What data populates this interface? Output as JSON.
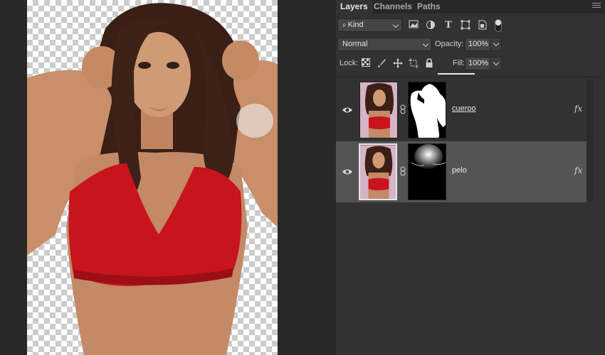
{
  "tabs": [
    {
      "label": "Layers",
      "active": true
    },
    {
      "label": "Channels",
      "active": false
    },
    {
      "label": "Paths",
      "active": false
    }
  ],
  "filter": {
    "kind_label": "Kind"
  },
  "blend": {
    "mode": "Normal",
    "opacity_label": "Opacity:",
    "opacity_value": "100%"
  },
  "lock": {
    "label": "Lock:",
    "fill_label": "Fill:",
    "fill_value": "100%"
  },
  "layers": [
    {
      "name": "cuerpo",
      "selected": false,
      "fx": "fx"
    },
    {
      "name": "pelo",
      "selected": true,
      "fx": "fx"
    }
  ],
  "colors": {
    "panel_bg": "#323232",
    "app_bg": "#282828",
    "selected_row": "#545454",
    "bra_red": "#c8141c",
    "hair": "#3a1f16"
  }
}
